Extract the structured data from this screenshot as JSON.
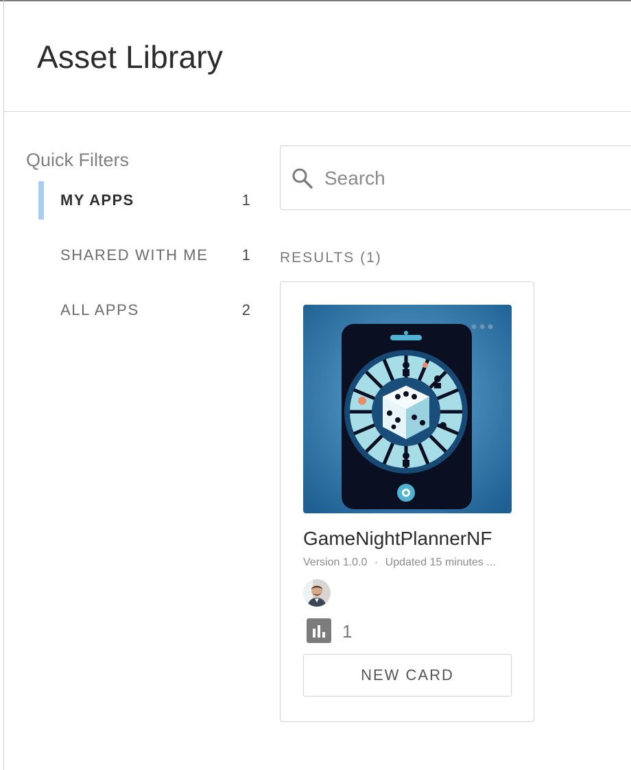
{
  "header": {
    "title": "Asset Library"
  },
  "quick_filters": {
    "heading": "Quick Filters",
    "items": [
      {
        "label": "MY APPS",
        "count": "1",
        "active": true
      },
      {
        "label": "SHARED WITH ME",
        "count": "1",
        "active": false
      },
      {
        "label": "ALL APPS",
        "count": "2",
        "active": false
      }
    ]
  },
  "search": {
    "placeholder": "Search",
    "value": ""
  },
  "results": {
    "label": "RESULTS (1)",
    "cards": [
      {
        "name": "GameNightPlannerNF",
        "version_label": "Version",
        "version": "1.0.0",
        "updated": "Updated 15 minutes ...",
        "stats_count": "1",
        "button_label": "NEW CARD"
      }
    ]
  },
  "icons": [
    "search-icon",
    "more-options-icon",
    "dice-icon",
    "stats-icon",
    "avatar"
  ],
  "colors": {
    "active_filter_bar": "#a9cdef",
    "thumbnail_bg": "#2f7aa8"
  }
}
